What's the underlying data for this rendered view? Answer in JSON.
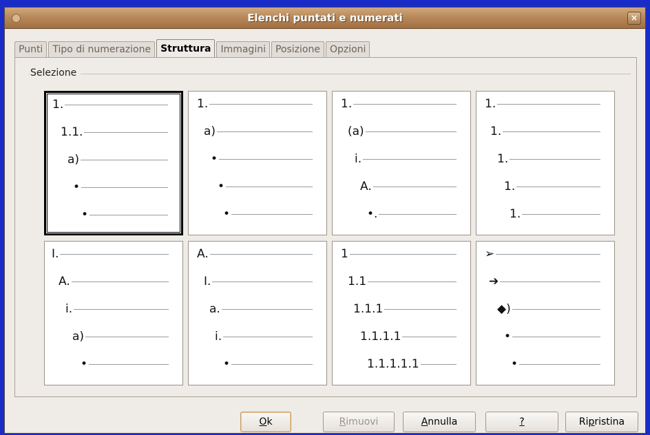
{
  "window": {
    "title": "Elenchi puntati e numerati",
    "close_glyph": "×"
  },
  "tabs": [
    {
      "label": "Punti",
      "active": false
    },
    {
      "label": "Tipo di numerazione",
      "active": false
    },
    {
      "label": "Struttura",
      "active": true
    },
    {
      "label": "Immagini",
      "active": false
    },
    {
      "label": "Posizione",
      "active": false
    },
    {
      "label": "Opzioni",
      "active": false
    }
  ],
  "group": {
    "label": "Selezione"
  },
  "presets": [
    {
      "selected": true,
      "levels": [
        "1.",
        "1.1.",
        "a)",
        "•",
        "•"
      ]
    },
    {
      "selected": false,
      "levels": [
        "1.",
        "a)",
        "•",
        "•",
        "•"
      ]
    },
    {
      "selected": false,
      "levels": [
        "1.",
        "(a)",
        "i.",
        "A.",
        "•."
      ]
    },
    {
      "selected": false,
      "levels": [
        "1.",
        "1.",
        "1.",
        "1.",
        "1."
      ]
    },
    {
      "selected": false,
      "levels": [
        "I.",
        "A.",
        "i.",
        "a)",
        "•"
      ]
    },
    {
      "selected": false,
      "levels": [
        "A.",
        "I.",
        "a.",
        "i.",
        "•"
      ]
    },
    {
      "selected": false,
      "levels": [
        "1",
        "1.1",
        "1.1.1",
        "1.1.1.1",
        "1.1.1.1.1"
      ]
    },
    {
      "selected": false,
      "levels": [
        "➢",
        "➔",
        "◆)",
        "•",
        "•"
      ]
    }
  ],
  "buttons": {
    "ok": {
      "prefix": "",
      "mnemonic": "O",
      "rest": "k"
    },
    "remove": {
      "prefix": "",
      "mnemonic": "R",
      "rest": "imuovi"
    },
    "cancel": {
      "prefix": "",
      "mnemonic": "A",
      "rest": "nnulla"
    },
    "help": {
      "prefix": "",
      "mnemonic": "?",
      "rest": ""
    },
    "reset": {
      "prefix": "Ri",
      "mnemonic": "p",
      "rest": "ristina"
    }
  }
}
